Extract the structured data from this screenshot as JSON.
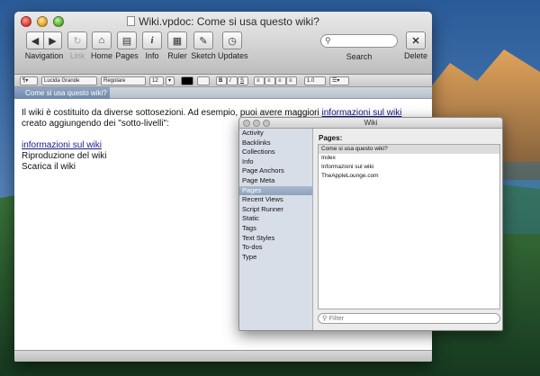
{
  "window": {
    "title": "Wiki.vpdoc: Come si usa questo wiki?"
  },
  "toolbar": {
    "navigation_label": "Navigation",
    "link_label": "Link",
    "home_label": "Home",
    "pages_label": "Pages",
    "info_label": "Info",
    "ruler_label": "Ruler",
    "sketch_label": "Sketch",
    "updates_label": "Updates",
    "search_label": "Search",
    "delete_label": "Delete",
    "search_placeholder": ""
  },
  "formatbar": {
    "paragraph_style": "¶▾",
    "font_family": "Lucida Grande",
    "font_style": "Regolare",
    "font_size": "12",
    "bold": "B",
    "italic": "I",
    "underline": "S",
    "line_spacing": "1.0",
    "list_style": "☰▾"
  },
  "tab": {
    "active": "Come si usa questo wiki?"
  },
  "content": {
    "paragraph_before": "Il wiki è costituito da diverse sottosezioni. Ad esempio, puoi avere maggiori ",
    "paragraph_link": "informazioni sul wiki",
    "paragraph_after": " creato aggiungendo dei \"sotto-livelli\":",
    "list": [
      "informazioni sul wiki",
      "Riproduzione del wiki",
      "Scarica il wiki"
    ]
  },
  "wiki_panel": {
    "title": "Wiki",
    "sidebar": [
      "Activity",
      "Backlinks",
      "Collections",
      "Info",
      "Page Anchors",
      "Page Meta",
      "Pages",
      "Recent Views",
      "Script Runner",
      "Static",
      "Tags",
      "Text Styles",
      "To-dos",
      "Type"
    ],
    "selected_index": 6,
    "heading": "Pages:",
    "pages": [
      "Come si usa questo wiki?",
      "Index",
      "Informazioni sul wiki",
      "TheAppleLounge.com"
    ],
    "selected_page_index": 0,
    "filter_placeholder": "Filter"
  },
  "colors": {
    "tab_active": "#7a91b2",
    "link": "#1a1a8a",
    "sidebar_bg": "#d8dee8"
  }
}
